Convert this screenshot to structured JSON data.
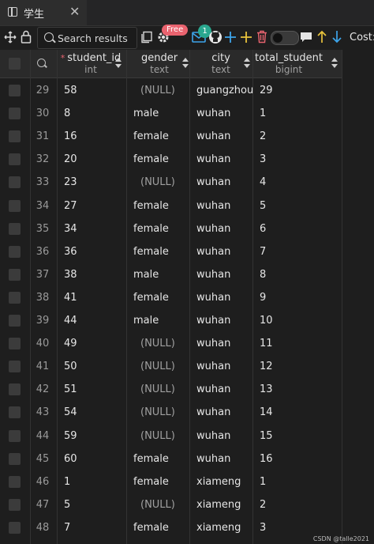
{
  "tab": {
    "title": "学生"
  },
  "toolbar": {
    "search_placeholder": "Search results",
    "free_badge": "Free",
    "count_badge": "1",
    "cost_label": "Cost:",
    "icons": [
      "move-icon",
      "lock-icon",
      "search-icon",
      "copy-icon",
      "gear-icon",
      "mail-icon",
      "github-icon",
      "plus-icon",
      "add-row-icon",
      "trash-icon",
      "toggle-switch",
      "comment-icon",
      "arrow-up-icon",
      "arrow-down-icon"
    ]
  },
  "columns": [
    {
      "name": "student_id",
      "type": "int",
      "required": "*"
    },
    {
      "name": "gender",
      "type": "text"
    },
    {
      "name": "city",
      "type": "text"
    },
    {
      "name": "total_student",
      "type": "bigint"
    }
  ],
  "rows": [
    [
      "29",
      "58",
      "(NULL)",
      "guangzhou",
      "29"
    ],
    [
      "30",
      "8",
      "male",
      "wuhan",
      "1"
    ],
    [
      "31",
      "16",
      "female",
      "wuhan",
      "2"
    ],
    [
      "32",
      "20",
      "female",
      "wuhan",
      "3"
    ],
    [
      "33",
      "23",
      "(NULL)",
      "wuhan",
      "4"
    ],
    [
      "34",
      "27",
      "female",
      "wuhan",
      "5"
    ],
    [
      "35",
      "34",
      "female",
      "wuhan",
      "6"
    ],
    [
      "36",
      "36",
      "female",
      "wuhan",
      "7"
    ],
    [
      "37",
      "38",
      "male",
      "wuhan",
      "8"
    ],
    [
      "38",
      "41",
      "female",
      "wuhan",
      "9"
    ],
    [
      "39",
      "44",
      "male",
      "wuhan",
      "10"
    ],
    [
      "40",
      "49",
      "(NULL)",
      "wuhan",
      "11"
    ],
    [
      "41",
      "50",
      "(NULL)",
      "wuhan",
      "12"
    ],
    [
      "42",
      "51",
      "(NULL)",
      "wuhan",
      "13"
    ],
    [
      "43",
      "54",
      "(NULL)",
      "wuhan",
      "14"
    ],
    [
      "44",
      "59",
      "(NULL)",
      "wuhan",
      "15"
    ],
    [
      "45",
      "60",
      "female",
      "wuhan",
      "16"
    ],
    [
      "46",
      "1",
      "female",
      "xiameng",
      "1"
    ],
    [
      "47",
      "5",
      "(NULL)",
      "xiameng",
      "2"
    ],
    [
      "48",
      "7",
      "female",
      "xiameng",
      "3"
    ]
  ],
  "watermark": "CSDN @talle2021",
  "colors": {
    "background": "#1e1e1e",
    "free_badge": "#e9636f",
    "count_badge": "#2aa78f",
    "plus": "#3da4ea",
    "add": "#e8c33c",
    "trash": "#e9636f",
    "up": "#e8c33c",
    "down": "#3da4ea"
  }
}
